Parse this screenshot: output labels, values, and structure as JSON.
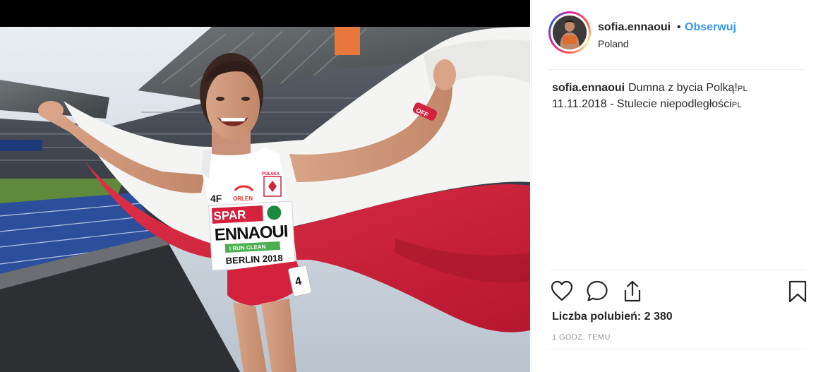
{
  "post": {
    "photo_alt": "Athlete celebrating with the Polish flag in a stadium",
    "bib": {
      "sponsor_top": "4F",
      "sponsor_orlen": "ORLEN",
      "spar": "SPAR",
      "name": "ENNAOUI",
      "run_clean": "I RUN CLEAN",
      "event": "BERLIN 2018",
      "polska": "POLSKA",
      "number": "4"
    },
    "wristband": "OFF"
  },
  "header": {
    "username": "sofia.ennaoui",
    "separator": "•",
    "follow_label": "Obserwuj",
    "location": "Poland"
  },
  "caption": {
    "username": "sofia.ennaoui",
    "line1_text": "Dumna z bycia Polką!",
    "line1_flag": "PL",
    "line2_text": "11.11.2018 - Stulecie niepodległości",
    "line2_flag": "PL"
  },
  "actions": {
    "like_icon": "heart-icon",
    "comment_icon": "comment-icon",
    "share_icon": "share-icon",
    "save_icon": "bookmark-icon"
  },
  "likes_text": "Liczba polubień: 2 380",
  "timestamp": "1 GODZ. TEMU",
  "colors": {
    "link_blue": "#3897f0",
    "text": "#262626",
    "muted": "#999999",
    "divider": "#efefef",
    "flag_red": "#d4213d",
    "flag_white": "#ffffff"
  }
}
